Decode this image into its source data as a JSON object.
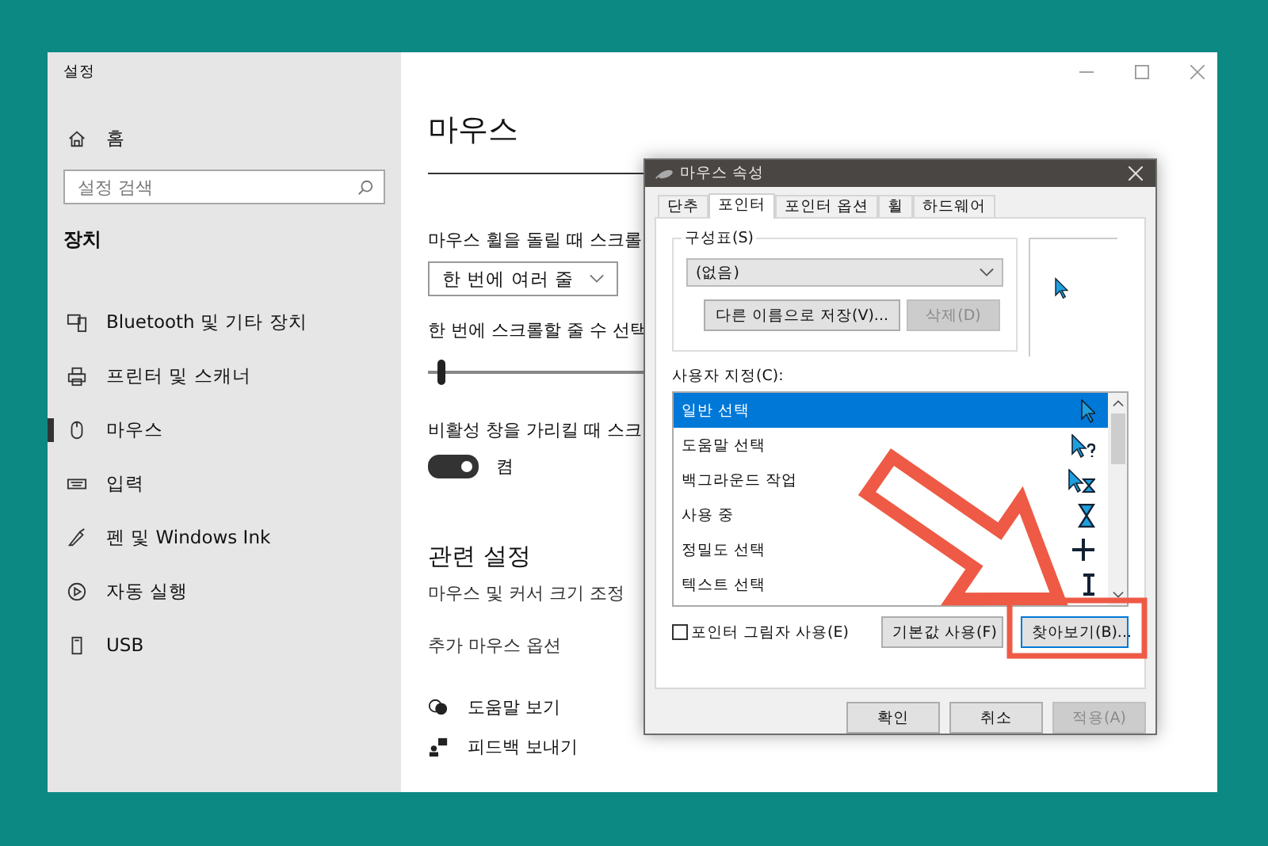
{
  "settings_window": {
    "title": "설정"
  },
  "sidebar": {
    "home": "홈",
    "search_placeholder": "설정 검색",
    "section": "장치",
    "items": [
      {
        "label": "Bluetooth 및 기타 장치",
        "selected": false
      },
      {
        "label": "프린터 및 스캐너",
        "selected": false
      },
      {
        "label": "마우스",
        "selected": true
      },
      {
        "label": "입력",
        "selected": false
      },
      {
        "label": "펜 및 Windows Ink",
        "selected": false
      },
      {
        "label": "자동 실행",
        "selected": false
      },
      {
        "label": "USB",
        "selected": false
      }
    ]
  },
  "page": {
    "title": "마우스",
    "wheel_label": "마우스 휠을 돌릴 때 스크롤",
    "wheel_dropdown": "한 번에 여러 줄",
    "lines_label": "한 번에 스크롤할 줄 수 선택",
    "lines_slider": {
      "level": 0.03
    },
    "inactive_label": "비활성 창을 가리킬 때 스크",
    "inactive_toggle": {
      "on": true,
      "label": "켬"
    },
    "related_title": "관련 설정",
    "related_links": [
      "마우스 및 커서 크기 조정",
      "추가 마우스 옵션"
    ],
    "help_links": [
      "도움말 보기",
      "피드백 보내기"
    ]
  },
  "dialog": {
    "title": "마우스 속성",
    "tabs": [
      {
        "label": "단추",
        "selected": false
      },
      {
        "label": "포인터",
        "selected": true
      },
      {
        "label": "포인터 옵션",
        "selected": false
      },
      {
        "label": "휠",
        "selected": false
      },
      {
        "label": "하드웨어",
        "selected": false
      }
    ],
    "scheme_label": "구성표(S)",
    "scheme_value": "(없음)",
    "save_as_button": "다른 이름으로 저장(V)...",
    "delete_button": {
      "label": "삭제(D)",
      "disabled": true
    },
    "customize_label": "사용자 지정(C):",
    "cursors": [
      {
        "name": "일반 선택",
        "selected": true
      },
      {
        "name": "도움말 선택",
        "selected": false
      },
      {
        "name": "백그라운드 작업",
        "selected": false
      },
      {
        "name": "사용 중",
        "selected": false
      },
      {
        "name": "정밀도 선택",
        "selected": false
      },
      {
        "name": "텍스트 선택",
        "selected": false
      }
    ],
    "shadow": {
      "label": "포인터 그림자 사용(E)",
      "checked": false
    },
    "default_button": "기본값 사용(F)",
    "browse_button": "찾아보기(B)...",
    "footer_buttons": [
      {
        "label": "확인",
        "disabled": false
      },
      {
        "label": "취소",
        "disabled": false
      },
      {
        "label": "적용(A)",
        "disabled": true
      }
    ]
  }
}
